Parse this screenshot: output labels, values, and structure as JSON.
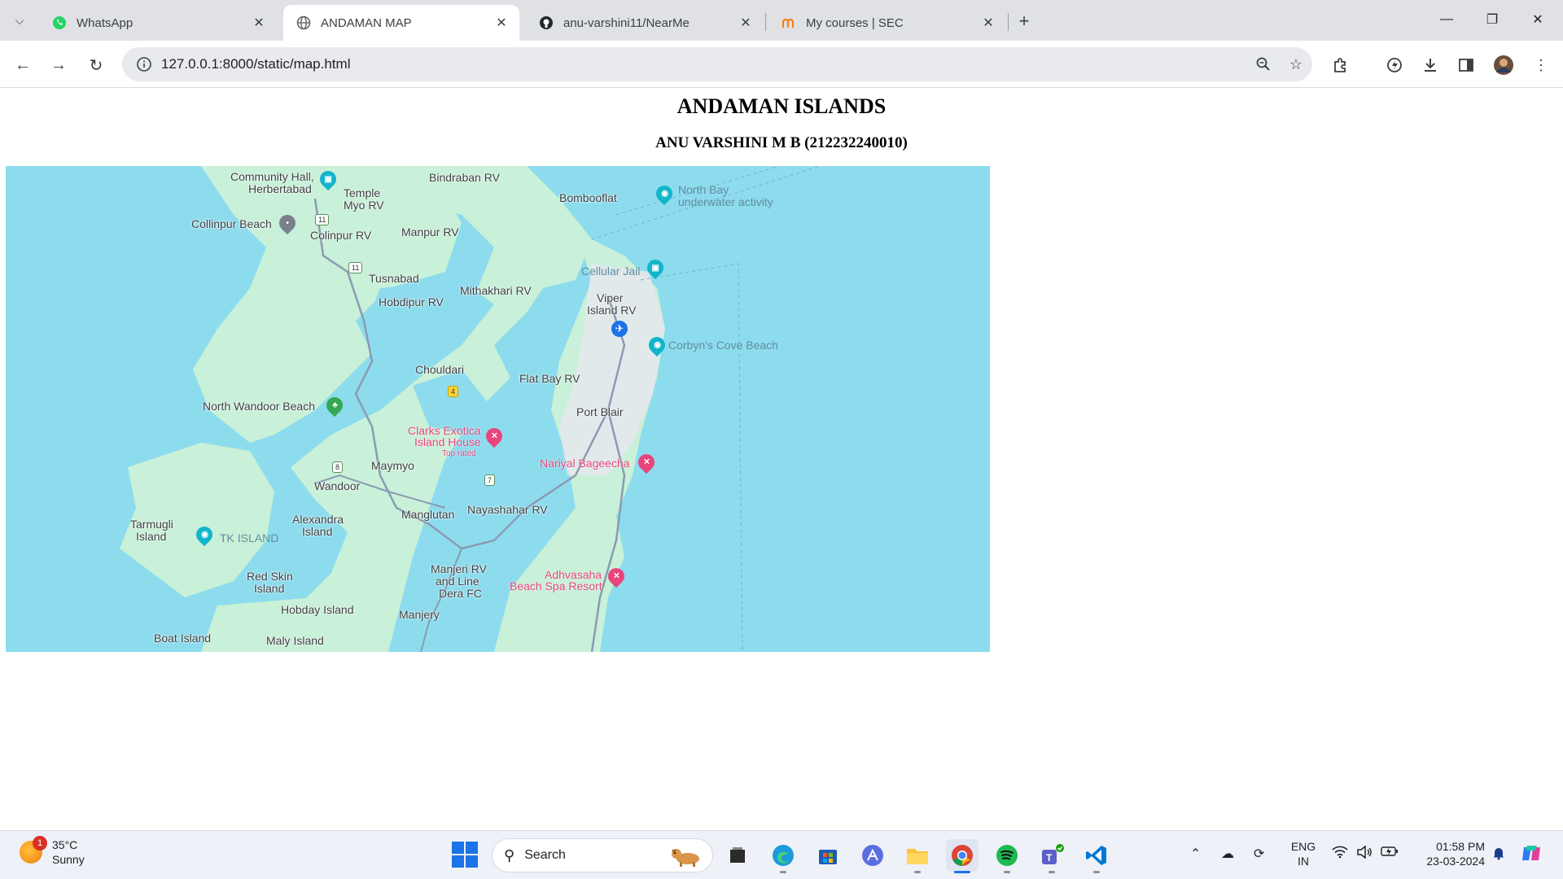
{
  "browser": {
    "tabs": [
      {
        "title": "WhatsApp",
        "icon": "whatsapp-icon",
        "active": false
      },
      {
        "title": "ANDAMAN MAP",
        "icon": "globe-icon",
        "active": true
      },
      {
        "title": "anu-varshini11/NearMe",
        "icon": "github-icon",
        "active": false
      },
      {
        "title": "My courses | SEC",
        "icon": "moodle-icon",
        "active": false
      }
    ],
    "address": "127.0.0.1:8000/static/map.html"
  },
  "page": {
    "title": "ANDAMAN ISLANDS",
    "subtitle": "ANU VARSHINI M B (212232240010)"
  },
  "map": {
    "labels": {
      "community_hall": "Community Hall,",
      "herbertabad": "Herbertabad",
      "temple_myo": "Temple",
      "temple_myo2": "Myo RV",
      "bindraban": "Bindraban RV",
      "bombooflat": "Bombooflat",
      "north_bay": "North Bay",
      "north_bay2": "underwater activity",
      "collinpur_beach": "Collinpur Beach",
      "colinpur": "Colinpur RV",
      "manpur": "Manpur RV",
      "tusnabad": "Tusnabad",
      "cellular_jail": "Cellular Jail",
      "hobdipur": "Hobdipur RV",
      "mithakhari": "Mithakhari RV",
      "viper": "Viper",
      "viper2": "Island RV",
      "corbyns": "Corbyn's Cove Beach",
      "chouldari": "Chouldari",
      "flat_bay": "Flat Bay RV",
      "north_wandoor": "North Wandoor Beach",
      "port_blair": "Port Blair",
      "clarks": "Clarks Exotica",
      "clarks2": "Island House",
      "top_rated": "Top rated",
      "nariyal": "Nariyal Bageecha",
      "maymyo": "Maymyo",
      "wandoor": "Wandoor",
      "manglutan": "Manglutan",
      "nayashahar": "Nayashahar RV",
      "tarmugli": "Tarmugli",
      "tarmugli2": "Island",
      "tk_island": "TK ISLAND",
      "alexandra": "Alexandra",
      "alexandra2": "Island",
      "manjeri": "Manjeri RV",
      "manjeri2": "and Line",
      "manjeri3": "Dera FC",
      "adhvasaha": "Adhvasaha",
      "adhvasaha2": "Beach Spa Resort",
      "red_skin": "Red Skin",
      "red_skin2": "Island",
      "hobday": "Hobday Island",
      "manjery": "Manjery",
      "boat_island": "Boat Island",
      "maly_island": "Maly Island"
    },
    "shields": {
      "r11a": "11",
      "r11b": "11",
      "r4": "4",
      "r8": "8",
      "r7": "7"
    }
  },
  "taskbar": {
    "weather_temp": "35°C",
    "weather_desc": "Sunny",
    "weather_badge": "1",
    "search_placeholder": "Search",
    "lang_top": "ENG",
    "lang_bottom": "IN",
    "time": "01:58 PM",
    "date": "23-03-2024"
  },
  "colors": {
    "water": "#8ddcee",
    "land": "#c9f0d8",
    "accent": "#1a73e8",
    "poi_pink": "#e8457d",
    "poi_teal": "#12b5cb"
  }
}
